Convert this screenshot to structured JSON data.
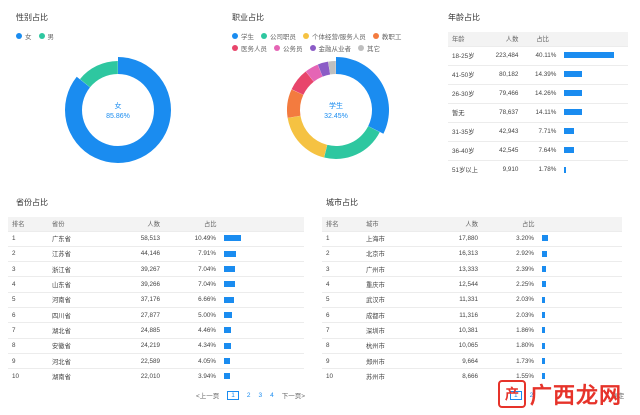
{
  "gender": {
    "title": "性别占比",
    "legend": [
      {
        "label": "女",
        "color": "#1a8cf0"
      },
      {
        "label": "男",
        "color": "#2ec7a0"
      }
    ],
    "center_label": "女",
    "center_value": "85.86%",
    "chart_data": {
      "type": "pie",
      "categories": [
        "女",
        "男"
      ],
      "values": [
        85.86,
        14.14
      ]
    }
  },
  "occupation": {
    "title": "职业占比",
    "legend": [
      {
        "label": "学生",
        "color": "#1a8cf0"
      },
      {
        "label": "公司职员",
        "color": "#2ec7a0"
      },
      {
        "label": "个体经营/服务人员",
        "color": "#f5c242"
      },
      {
        "label": "教职工",
        "color": "#f37b3f"
      },
      {
        "label": "医务人员",
        "color": "#e8456b"
      },
      {
        "label": "公务员",
        "color": "#e565b5"
      },
      {
        "label": "金融从业者",
        "color": "#8b5cc6"
      },
      {
        "label": "其它",
        "color": "#bfbfbf"
      }
    ],
    "center_label": "学生",
    "center_value": "32.45%",
    "chart_data": {
      "type": "pie",
      "categories": [
        "学生",
        "公司职员",
        "个体经营/服务人员",
        "教职工",
        "医务人员",
        "公务员",
        "金融从业者",
        "其它"
      ],
      "values": [
        32.45,
        21.5,
        18.5,
        9.5,
        7.5,
        4.5,
        3.5,
        2.55
      ]
    }
  },
  "age": {
    "title": "年龄占比",
    "headers": [
      "年龄",
      "人数",
      "占比"
    ],
    "rows": [
      {
        "label": "18-25岁",
        "count": "223,484",
        "pct": "40.11%",
        "v": 40.11
      },
      {
        "label": "41-50岁",
        "count": "80,182",
        "pct": "14.39%",
        "v": 14.39
      },
      {
        "label": "26-30岁",
        "count": "79,466",
        "pct": "14.26%",
        "v": 14.26
      },
      {
        "label": "暂无",
        "count": "78,637",
        "pct": "14.11%",
        "v": 14.11
      },
      {
        "label": "31-35岁",
        "count": "42,943",
        "pct": "7.71%",
        "v": 7.71
      },
      {
        "label": "36-40岁",
        "count": "42,545",
        "pct": "7.64%",
        "v": 7.64
      },
      {
        "label": "51岁以上",
        "count": "9,910",
        "pct": "1.78%",
        "v": 1.78
      }
    ]
  },
  "province": {
    "title": "省份占比",
    "headers": [
      "排名",
      "省份",
      "人数",
      "占比"
    ],
    "rows": [
      {
        "rank": "1",
        "name": "广东省",
        "count": "58,513",
        "pct": "10.49%",
        "v": 10.49
      },
      {
        "rank": "2",
        "name": "江苏省",
        "count": "44,146",
        "pct": "7.91%",
        "v": 7.91
      },
      {
        "rank": "3",
        "name": "浙江省",
        "count": "39,267",
        "pct": "7.04%",
        "v": 7.04
      },
      {
        "rank": "4",
        "name": "山东省",
        "count": "39,266",
        "pct": "7.04%",
        "v": 7.04
      },
      {
        "rank": "5",
        "name": "河南省",
        "count": "37,176",
        "pct": "6.66%",
        "v": 6.66
      },
      {
        "rank": "6",
        "name": "四川省",
        "count": "27,877",
        "pct": "5.00%",
        "v": 5.0
      },
      {
        "rank": "7",
        "name": "湖北省",
        "count": "24,885",
        "pct": "4.46%",
        "v": 4.46
      },
      {
        "rank": "8",
        "name": "安徽省",
        "count": "24,219",
        "pct": "4.34%",
        "v": 4.34
      },
      {
        "rank": "9",
        "name": "河北省",
        "count": "22,589",
        "pct": "4.05%",
        "v": 4.05
      },
      {
        "rank": "10",
        "name": "湖南省",
        "count": "22,010",
        "pct": "3.94%",
        "v": 3.94
      }
    ],
    "pager": {
      "prev": "<上一页",
      "pages": [
        "1",
        "2",
        "3",
        "4"
      ],
      "next": "下一页>"
    }
  },
  "city": {
    "title": "城市占比",
    "headers": [
      "排名",
      "城市",
      "人数",
      "占比"
    ],
    "rows": [
      {
        "rank": "1",
        "name": "上海市",
        "count": "17,880",
        "pct": "3.20%",
        "v": 3.2
      },
      {
        "rank": "2",
        "name": "北京市",
        "count": "16,313",
        "pct": "2.92%",
        "v": 2.92
      },
      {
        "rank": "3",
        "name": "广州市",
        "count": "13,333",
        "pct": "2.39%",
        "v": 2.39
      },
      {
        "rank": "4",
        "name": "重庆市",
        "count": "12,544",
        "pct": "2.25%",
        "v": 2.25
      },
      {
        "rank": "5",
        "name": "武汉市",
        "count": "11,331",
        "pct": "2.03%",
        "v": 2.03
      },
      {
        "rank": "6",
        "name": "成都市",
        "count": "11,316",
        "pct": "2.03%",
        "v": 2.03
      },
      {
        "rank": "7",
        "name": "深圳市",
        "count": "10,381",
        "pct": "1.86%",
        "v": 1.86
      },
      {
        "rank": "8",
        "name": "杭州市",
        "count": "10,065",
        "pct": "1.80%",
        "v": 1.8
      },
      {
        "rank": "9",
        "name": "郑州市",
        "count": "9,664",
        "pct": "1.73%",
        "v": 1.73
      },
      {
        "rank": "10",
        "name": "苏州市",
        "count": "8,666",
        "pct": "1.55%",
        "v": 1.55
      }
    ],
    "pager": {
      "pages": [
        "1",
        "2"
      ],
      "confirm": "确定"
    }
  },
  "watermark": {
    "box": "产",
    "text": "广西龙网"
  }
}
